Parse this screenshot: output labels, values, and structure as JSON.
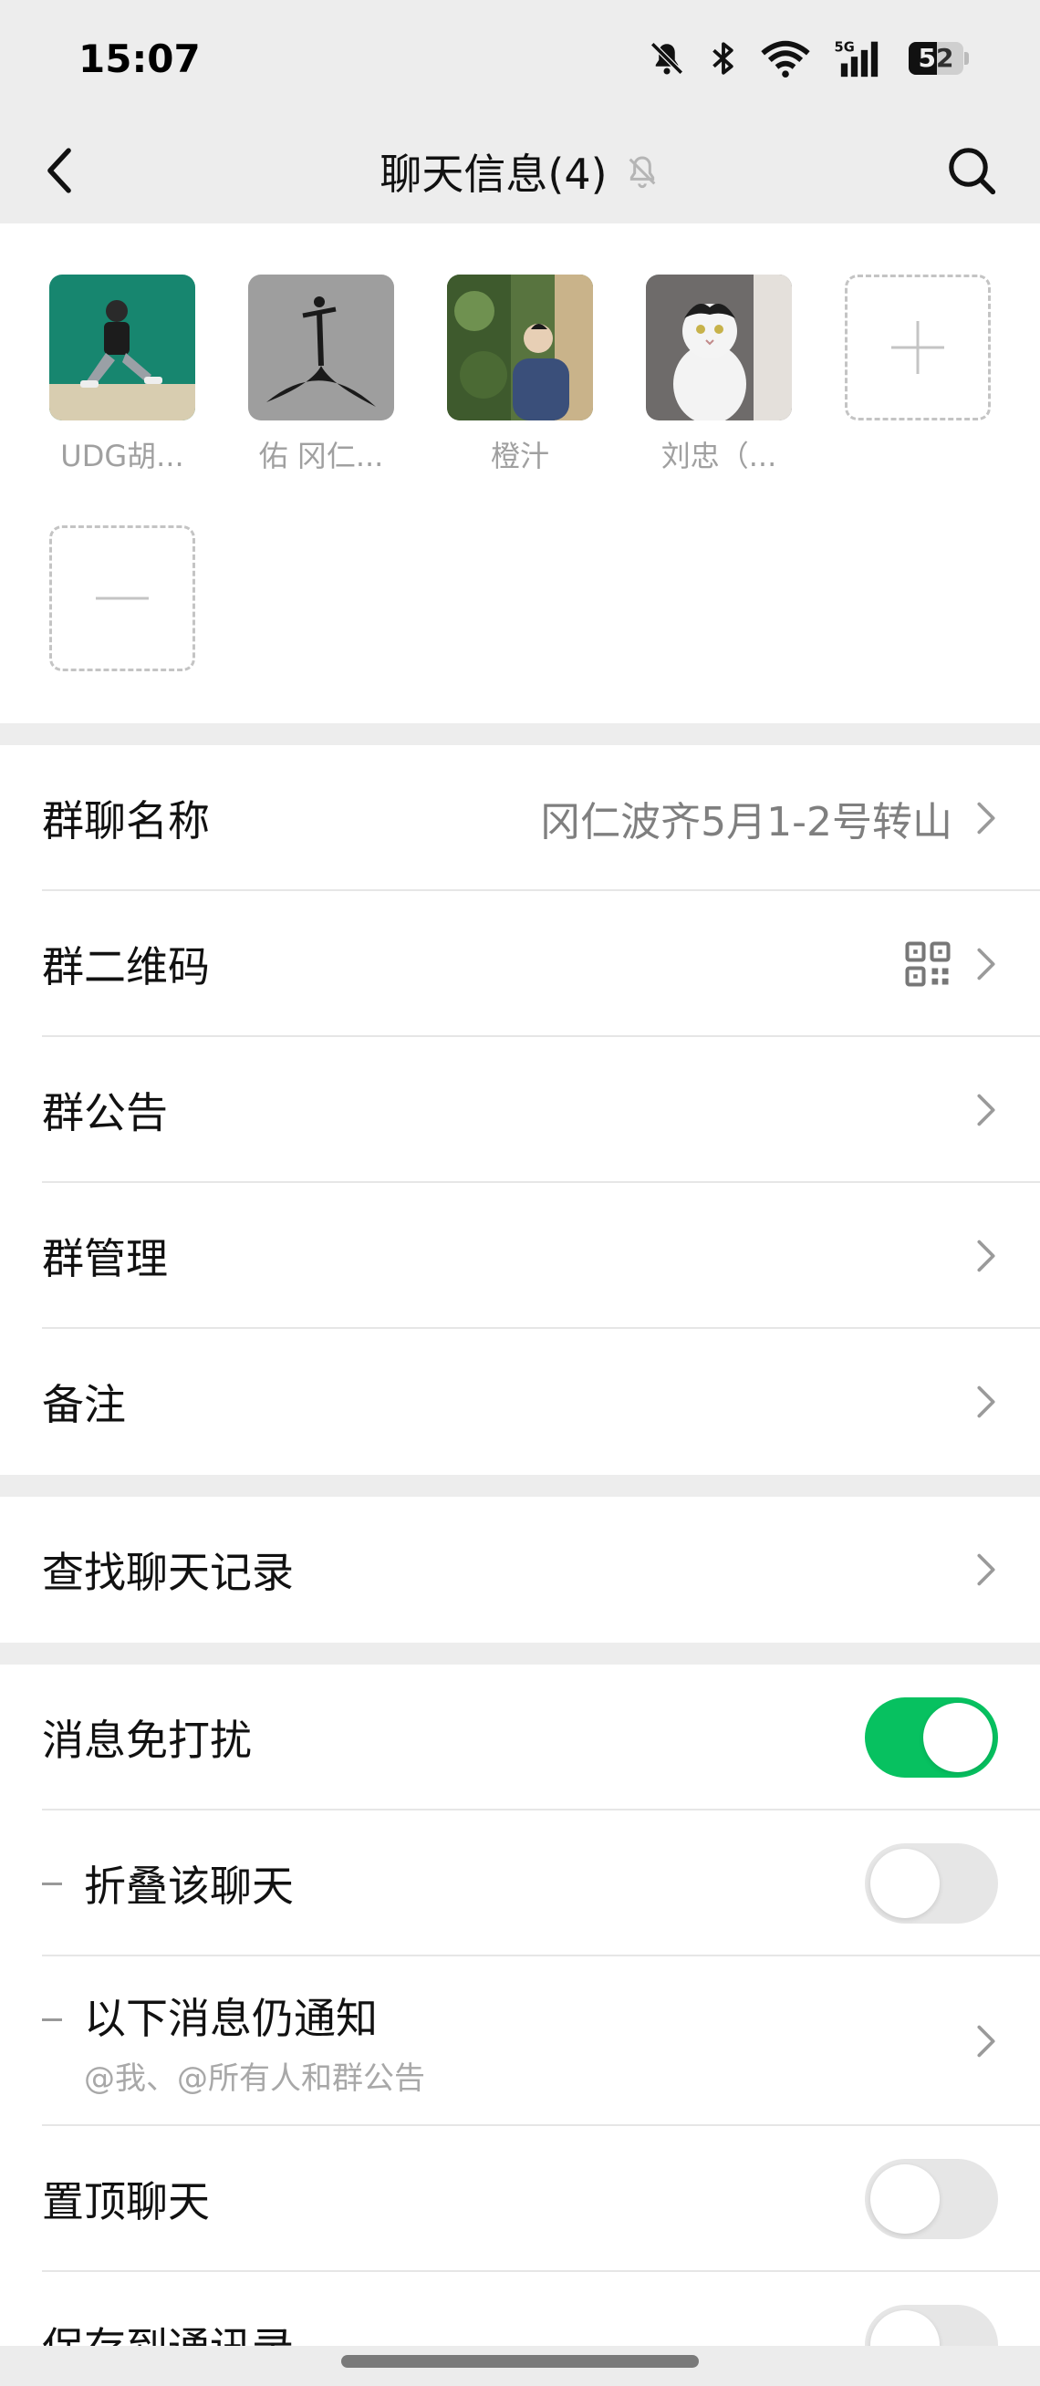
{
  "status_bar": {
    "time": "15:07",
    "icons": [
      "bell-muted-icon",
      "bluetooth-icon",
      "wifi-icon",
      "signal-5g-icon",
      "battery-icon"
    ],
    "network": "5G",
    "battery_level": "52",
    "battery_fraction": 0.52
  },
  "nav": {
    "title": "聊天信息(4)",
    "muted_icon": "bell-muted-icon",
    "back_icon": "chevron-left-icon",
    "search_icon": "search-icon"
  },
  "members": [
    {
      "name": "UDG胡...",
      "avatar_icon": "avatar-photo",
      "bg": "#1a8a73"
    },
    {
      "name": "佑 冈仁...",
      "avatar_icon": "avatar-photo",
      "bg": "#8d8d8d"
    },
    {
      "name": "橙汁",
      "avatar_icon": "avatar-photo",
      "bg": "#4f6b3c"
    },
    {
      "name": "刘忠（...",
      "avatar_icon": "avatar-photo",
      "bg": "#7a7574"
    }
  ],
  "member_actions": {
    "add_icon": "plus-icon",
    "remove_icon": "minus-icon"
  },
  "group_settings": {
    "name_label": "群聊名称",
    "name_value": "冈仁波齐5月1-2号转山",
    "qrcode_label": "群二维码",
    "qrcode_icon": "qrcode-icon",
    "announcement_label": "群公告",
    "manage_label": "群管理",
    "remark_label": "备注"
  },
  "search_history": {
    "label": "查找聊天记录"
  },
  "notifications": {
    "dnd_label": "消息免打扰",
    "dnd_on": true,
    "fold_label": "折叠该聊天",
    "fold_on": false,
    "still_notify_label": "以下消息仍通知",
    "still_notify_sub": "@我、@所有人和群公告",
    "pin_label": "置顶聊天",
    "pin_on": false,
    "save_contacts_label": "保存到通讯录",
    "save_on": false
  },
  "colors": {
    "accent": "#07c160",
    "background": "#ededed",
    "card": "#ffffff"
  }
}
